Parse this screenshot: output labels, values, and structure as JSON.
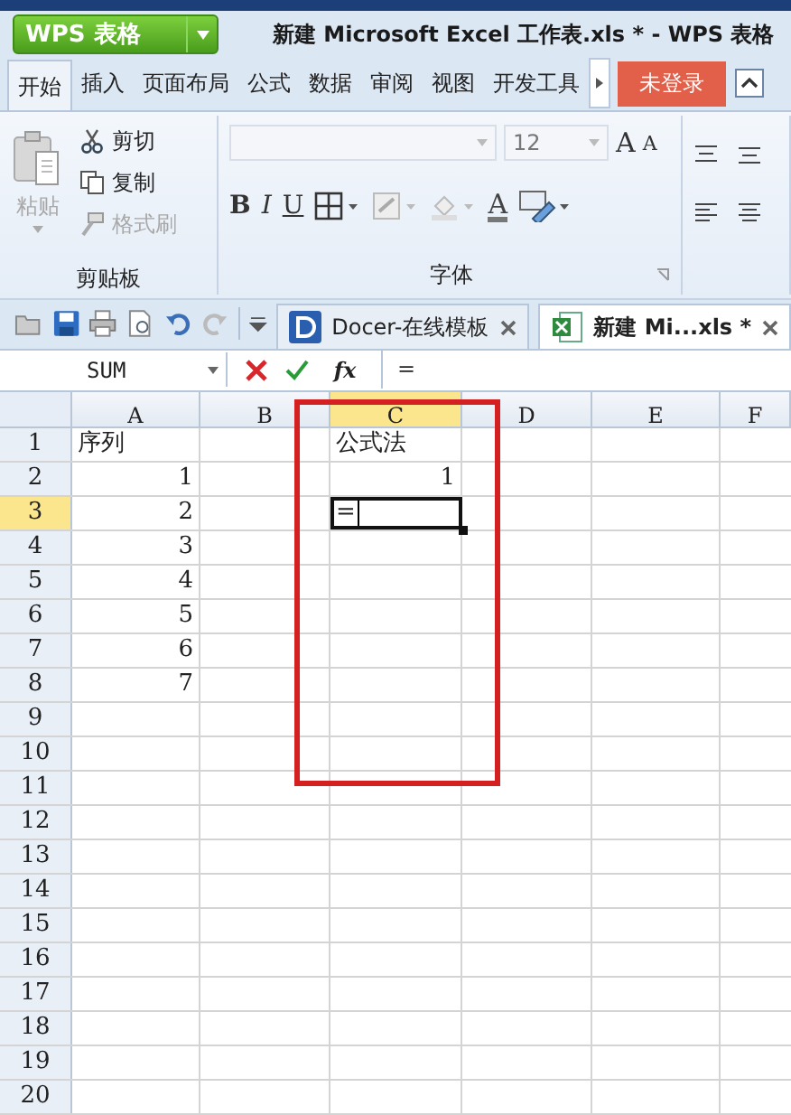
{
  "app": {
    "brand": "WPS 表格",
    "title": "新建 Microsoft Excel 工作表.xls * - WPS 表格"
  },
  "menu_tabs": [
    {
      "label": "开始",
      "selected": true
    },
    {
      "label": "插入",
      "selected": false
    },
    {
      "label": "页面布局",
      "selected": false
    },
    {
      "label": "公式",
      "selected": false
    },
    {
      "label": "数据",
      "selected": false
    },
    {
      "label": "审阅",
      "selected": false
    },
    {
      "label": "视图",
      "selected": false
    },
    {
      "label": "开发工具",
      "selected": false
    }
  ],
  "login_button": "未登录",
  "clipboard": {
    "label": "剪贴板",
    "paste": {
      "label": "粘贴",
      "disabled": true
    },
    "cut": {
      "label": "剪切",
      "disabled": false
    },
    "copy": {
      "label": "复制",
      "disabled": false
    },
    "format_painter": {
      "label": "格式刷",
      "disabled": true
    }
  },
  "font": {
    "label": "字体",
    "size": "12",
    "grow": "A",
    "shrink": "A",
    "bold": "B",
    "italic": "I",
    "underline": "U",
    "font_color_button": "A"
  },
  "doc_tabs": [
    {
      "label": "Docer-在线模板",
      "selected": false,
      "kind": "docer"
    },
    {
      "label": "新建 Mi...xls *",
      "selected": true,
      "kind": "sheet"
    }
  ],
  "formula_bar": {
    "name_box": "SUM",
    "fx": "fx",
    "formula": "="
  },
  "sheet": {
    "columns": [
      {
        "label": "A",
        "selected": false
      },
      {
        "label": "B",
        "selected": false
      },
      {
        "label": "C",
        "selected": true
      },
      {
        "label": "D",
        "selected": false
      },
      {
        "label": "E",
        "selected": false
      },
      {
        "label": "F",
        "selected": false
      }
    ],
    "rows": [
      {
        "label": "1",
        "selected": false,
        "cells": [
          {
            "text": "序列",
            "kind": "text"
          },
          {
            "kind": "empty"
          },
          {
            "text": "公式法",
            "kind": "text"
          }
        ]
      },
      {
        "label": "2",
        "selected": false,
        "cells": [
          {
            "text": "1",
            "kind": "number"
          },
          {
            "kind": "empty"
          },
          {
            "text": "1",
            "kind": "number"
          }
        ]
      },
      {
        "label": "3",
        "selected": true,
        "cells": [
          {
            "text": "2",
            "kind": "number"
          },
          {
            "kind": "empty"
          },
          {
            "text": "=",
            "kind": "editing"
          }
        ]
      },
      {
        "label": "4",
        "selected": false,
        "cells": [
          {
            "text": "3",
            "kind": "number"
          }
        ]
      },
      {
        "label": "5",
        "selected": false,
        "cells": [
          {
            "text": "4",
            "kind": "number"
          }
        ]
      },
      {
        "label": "6",
        "selected": false,
        "cells": [
          {
            "text": "5",
            "kind": "number"
          }
        ]
      },
      {
        "label": "7",
        "selected": false,
        "cells": [
          {
            "text": "6",
            "kind": "number"
          }
        ]
      },
      {
        "label": "8",
        "selected": false,
        "cells": [
          {
            "text": "7",
            "kind": "number"
          }
        ]
      },
      {
        "label": "9",
        "selected": false
      },
      {
        "label": "10",
        "selected": false
      },
      {
        "label": "11",
        "selected": false
      },
      {
        "label": "12",
        "selected": false
      },
      {
        "label": "13",
        "selected": false
      },
      {
        "label": "14",
        "selected": false
      },
      {
        "label": "15",
        "selected": false
      },
      {
        "label": "16",
        "selected": false
      },
      {
        "label": "17",
        "selected": false
      },
      {
        "label": "18",
        "selected": false
      },
      {
        "label": "19",
        "selected": false
      },
      {
        "label": "20",
        "selected": false
      }
    ],
    "annotation": {
      "kind": "rectangle"
    }
  }
}
